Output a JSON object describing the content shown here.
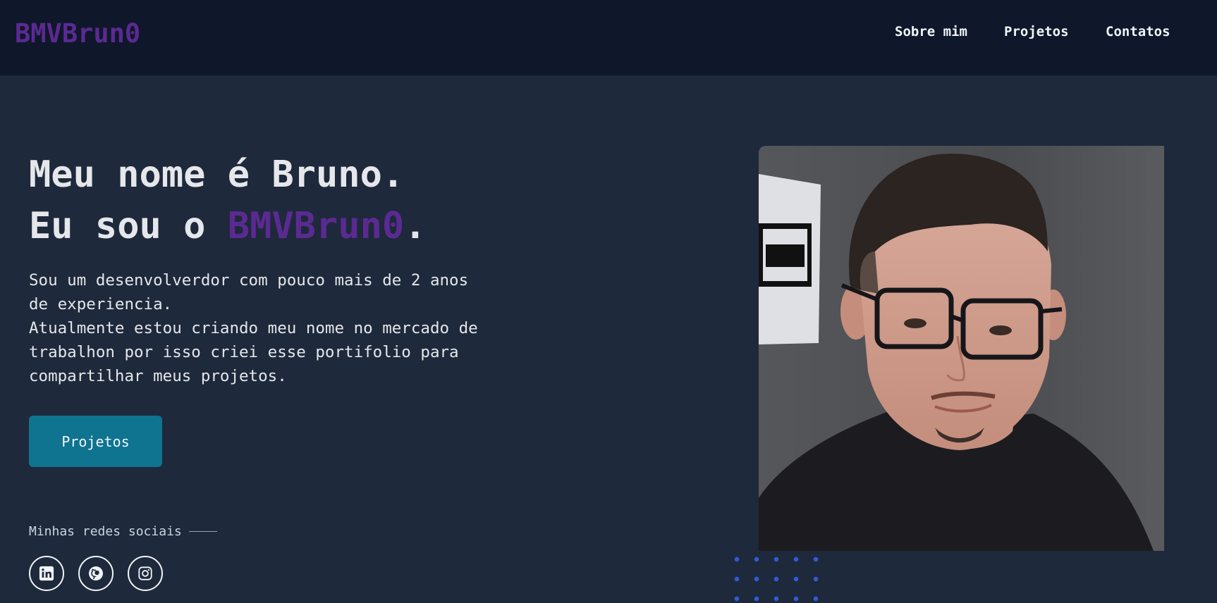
{
  "header": {
    "logo": "BMVBrun0",
    "nav": [
      {
        "label": "Sobre mim"
      },
      {
        "label": "Projetos"
      },
      {
        "label": "Contatos"
      }
    ]
  },
  "hero": {
    "line1": "Meu nome é Bruno.",
    "line2_prefix": "Eu sou o ",
    "line2_name": "BMVBrun0",
    "line2_suffix": ".",
    "bio_p1": "Sou um desenvolverdor com pouco mais de 2 anos de experiencia.",
    "bio_p2": "Atualmente estou criando meu nome no mercado de trabalhon por isso criei esse portifolio para compartilhar meus projetos.",
    "cta_label": "Projetos"
  },
  "social": {
    "label": "Minhas redes sociais",
    "items": [
      {
        "icon": "linkedin-icon"
      },
      {
        "icon": "github-icon"
      },
      {
        "icon": "instagram-icon"
      }
    ]
  },
  "colors": {
    "background": "#1e293b",
    "header": "#0f172a",
    "accent": "#5b2a91",
    "button": "#0e7490",
    "dots": "#2f5bd8"
  }
}
